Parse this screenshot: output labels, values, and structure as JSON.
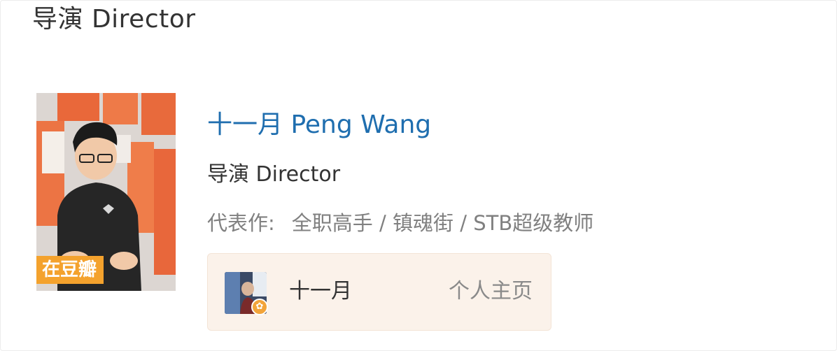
{
  "section": {
    "title": "导演 Director"
  },
  "person": {
    "name": "十一月 Peng Wang",
    "role": "导演 Director",
    "works_label": "代表作:",
    "works": "全职高手 / 镇魂街 / STB超级教师",
    "photo_badge": "在豆瓣"
  },
  "profile": {
    "name": "十一月",
    "link_label": "个人主页",
    "badge_icon": "verified-star-icon"
  },
  "colors": {
    "name_link": "#1f6eaf",
    "badge": "#f4a22d",
    "profile_bg": "#fbf2ea"
  }
}
